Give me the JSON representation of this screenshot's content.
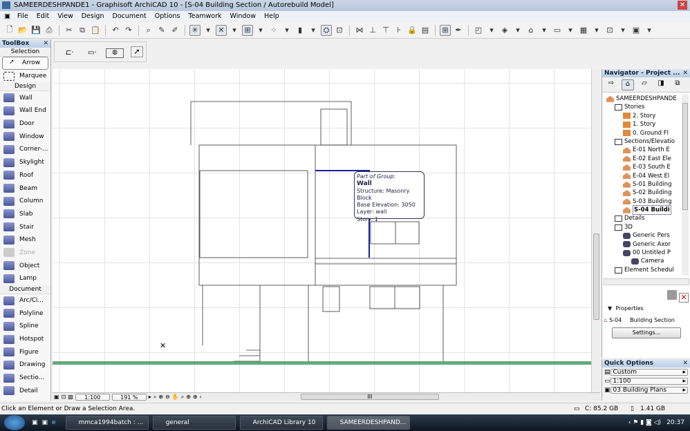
{
  "window": {
    "title": "SAMEERDESHPANDE1 - Graphisoft ArchiCAD 10 - [S-04 Building Section / Autorebuild Model]"
  },
  "menu": [
    "File",
    "Edit",
    "View",
    "Design",
    "Document",
    "Options",
    "Teamwork",
    "Window",
    "Help"
  ],
  "toolbox": {
    "title": "ToolBox",
    "groups": {
      "selection": "Selection",
      "design": "Design",
      "document": "Document"
    },
    "selection": [
      "Arrow",
      "Marquee"
    ],
    "design": [
      "Wall",
      "Wall End",
      "Door",
      "Window",
      "Corner-...",
      "Skylight",
      "Roof",
      "Beam",
      "Column",
      "Slab",
      "Stair",
      "Mesh",
      "Zone",
      "Object",
      "Lamp"
    ],
    "document": [
      "Arc/Ci...",
      "Polyline",
      "Spline",
      "Hotspot",
      "Figure",
      "Drawing",
      "Sectio...",
      "Detail"
    ]
  },
  "tooltip": {
    "heading": "Part of Group:",
    "type": "Wall",
    "structure": "Structure: Masonry Block",
    "elevation": "Base Elevation: 3050",
    "layer": "Layer: wall",
    "story": "Story: 1"
  },
  "view": {
    "scale": "1:100",
    "zoom": "191 %"
  },
  "navigator": {
    "title": "Navigator - Project ...",
    "tree": [
      {
        "label": "SAMEERDESHPANDE",
        "level": 0,
        "icon": "house"
      },
      {
        "label": "Stories",
        "level": 1,
        "icon": "box"
      },
      {
        "label": "2. Story",
        "level": 2,
        "icon": "folder"
      },
      {
        "label": "1. Story",
        "level": 2,
        "icon": "folder"
      },
      {
        "label": "0. Ground Fl",
        "level": 2,
        "icon": "folder"
      },
      {
        "label": "Sections/Elevatio",
        "level": 1,
        "icon": "box"
      },
      {
        "label": "E-01 North E",
        "level": 2,
        "icon": "house"
      },
      {
        "label": "E-02 East Ele",
        "level": 2,
        "icon": "house"
      },
      {
        "label": "E-03 South E",
        "level": 2,
        "icon": "house"
      },
      {
        "label": "E-04 West El",
        "level": 2,
        "icon": "house"
      },
      {
        "label": "S-01 Building",
        "level": 2,
        "icon": "house"
      },
      {
        "label": "S-02 Building",
        "level": 2,
        "icon": "house"
      },
      {
        "label": "S-03 Building",
        "level": 2,
        "icon": "house"
      },
      {
        "label": "S-04 Buildi",
        "level": 2,
        "icon": "house",
        "selected": true
      },
      {
        "label": "Details",
        "level": 1,
        "icon": "box"
      },
      {
        "label": "3D",
        "level": 1,
        "icon": "box"
      },
      {
        "label": "Generic Pers",
        "level": 2,
        "icon": "camera"
      },
      {
        "label": "Generic Axor",
        "level": 2,
        "icon": "camera"
      },
      {
        "label": "00 Untitled P",
        "level": 2,
        "icon": "camera"
      },
      {
        "label": "Camera",
        "level": 3,
        "icon": "camera"
      },
      {
        "label": "Element Schedul",
        "level": 1,
        "icon": "box"
      }
    ],
    "properties": {
      "label": "Properties",
      "id": "S-04",
      "name": "Building Section",
      "settings": "Settings..."
    }
  },
  "quick_options": {
    "title": "Quick Options",
    "rows": [
      "Custom",
      "1:100",
      "03 Building Plans"
    ]
  },
  "status": {
    "message": "Click an Element or Draw a Selection Area.",
    "disk": "C: 85.2 GB",
    "memory": "1.41 GB"
  },
  "taskbar": {
    "items": [
      "mmca1994batch : ...",
      "general",
      "ArchiCAD Library 10",
      "SAMEERDESHPAND..."
    ],
    "clock": "20:37"
  },
  "colors": {
    "selection": "#1a1aa0",
    "grid": "#e3e3e3",
    "ground": "#2f8f4f"
  }
}
